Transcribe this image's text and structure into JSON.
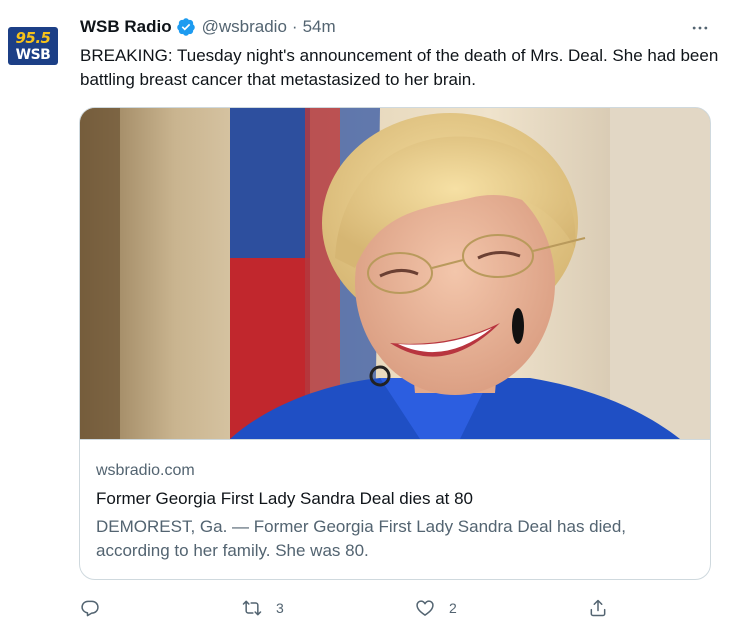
{
  "account": {
    "avatar_top": "95.5",
    "avatar_bottom": "WSB",
    "name": "WSB Radio",
    "handle": "@wsbradio",
    "separator": "·",
    "time": "54m",
    "verified_icon": "verified-badge-icon"
  },
  "tweet": {
    "text": "BREAKING: Tuesday night's announcement of the death of Mrs. Deal. She had been battling breast cancer that metastasized to her brain."
  },
  "card": {
    "domain": "wsbradio.com",
    "title": "Former Georgia First Lady Sandra Deal dies at 80",
    "description": "DEMOREST, Ga. — Former Georgia First Lady Sandra Deal has died, according to her family. She was 80."
  },
  "actions": {
    "reply_icon": "reply-icon",
    "retweet_icon": "retweet-icon",
    "retweet_count": "3",
    "like_icon": "heart-icon",
    "like_count": "2",
    "share_icon": "share-icon"
  },
  "colors": {
    "text": "#0f1419",
    "secondary": "#536471",
    "verified": "#1d9bf0",
    "border": "#cfd9de"
  }
}
